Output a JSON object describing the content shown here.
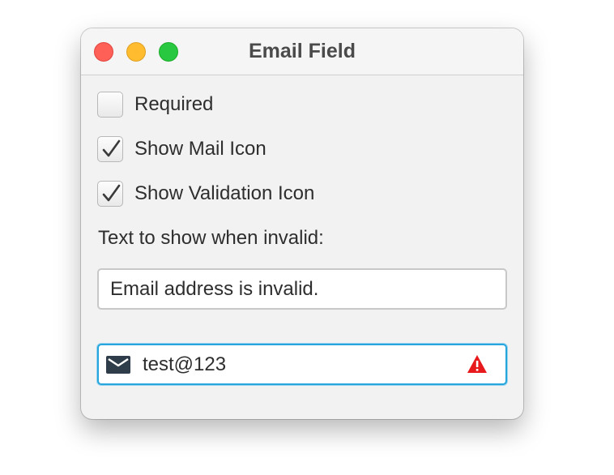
{
  "window": {
    "title": "Email Field"
  },
  "checkboxes": [
    {
      "label": "Required",
      "checked": false
    },
    {
      "label": "Show Mail Icon",
      "checked": true
    },
    {
      "label": "Show Validation Icon",
      "checked": true
    }
  ],
  "invalid_text": {
    "label": "Text to show when invalid:",
    "value": "Email address is invalid."
  },
  "email_field": {
    "value": "test@123",
    "leading_icon": "mail-icon",
    "trailing_icon": "warning-icon",
    "focus_color": "#26a6dc",
    "warning_color": "#e8191c"
  },
  "colors": {
    "close": "#fe5f57",
    "minimize": "#febc2e",
    "zoom": "#28c840"
  }
}
